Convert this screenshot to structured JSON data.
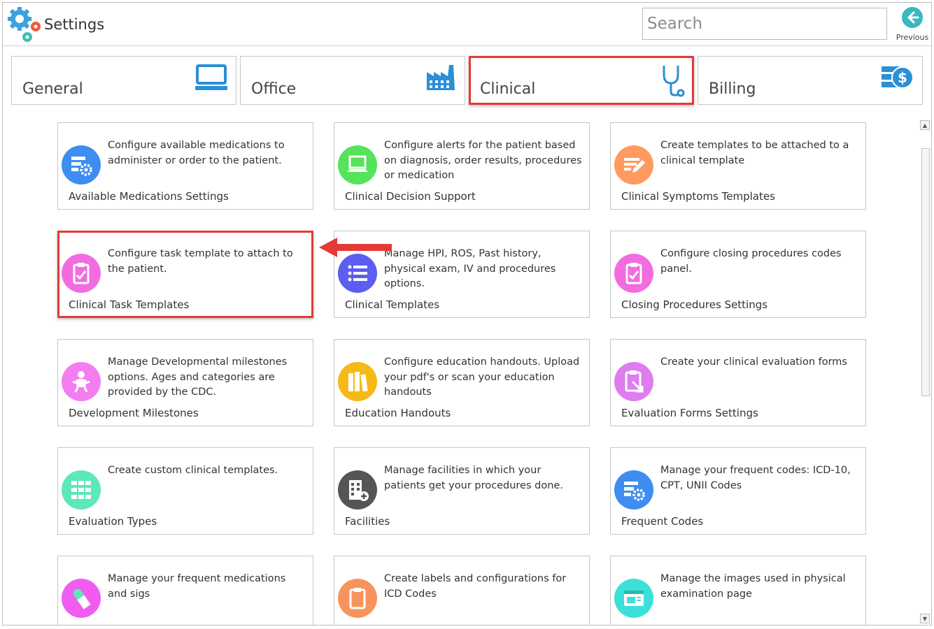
{
  "app": {
    "title": "Settings",
    "logo_icon": "gears-icon"
  },
  "search": {
    "placeholder": "Search"
  },
  "previous": {
    "label": "Previous",
    "icon": "arrow-left-icon"
  },
  "tabs": [
    {
      "label": "General",
      "icon": "monitor-icon",
      "selected": false
    },
    {
      "label": "Office",
      "icon": "factory-icon",
      "selected": false
    },
    {
      "label": "Clinical",
      "icon": "stethoscope-icon",
      "selected": true
    },
    {
      "label": "Billing",
      "icon": "money-icon",
      "selected": false
    }
  ],
  "cards": [
    {
      "title": "Available Medications Settings",
      "desc": "Configure available medications to administer or order to the patient.",
      "icon": "settings-list-icon",
      "color": "#3d8ef0"
    },
    {
      "title": "Clinical Decision Support",
      "desc": "Configure alerts for the patient based on diagnosis, order results, procedures or medication",
      "icon": "laptop-icon",
      "color": "#54e35a"
    },
    {
      "title": "Clinical Symptoms Templates",
      "desc": "Create templates to be attached to a clinical template",
      "icon": "edit-lines-icon",
      "color": "#ff9b5e"
    },
    {
      "title": "Clinical Task Templates",
      "desc": "Configure task template to attach to the patient.",
      "icon": "clipboard-check-icon",
      "color": "#f26ce0",
      "highlighted": true
    },
    {
      "title": "Clinical Templates",
      "desc": "Manage HPI, ROS, Past history, physical exam, IV and procedures options.",
      "icon": "list-icon",
      "color": "#5b5ef0"
    },
    {
      "title": "Closing Procedures Settings",
      "desc": "Configure closing procedures codes panel.",
      "icon": "clipboard-check-icon",
      "color": "#f26ce0"
    },
    {
      "title": "Development Milestones",
      "desc": "Manage Developmental milestones options. Ages and categories are provided by the CDC.",
      "icon": "baby-icon",
      "color": "#f47df0"
    },
    {
      "title": "Education Handouts",
      "desc": "Configure education handouts. Upload your pdf's or scan your education handouts",
      "icon": "books-icon",
      "color": "#f5b918"
    },
    {
      "title": "Evaluation Forms Settings",
      "desc": "Create your clinical evaluation forms",
      "icon": "form-icon",
      "color": "#df7df0"
    },
    {
      "title": "Evaluation Types",
      "desc": "Create custom clinical templates.",
      "icon": "grid-icon",
      "color": "#5ce8b8"
    },
    {
      "title": "Facilities",
      "desc": "Manage facilities in which your patients get your procedures done.",
      "icon": "building-add-icon",
      "color": "#555555"
    },
    {
      "title": "Frequent Codes",
      "desc": "Manage your frequent codes: ICD-10, CPT, UNII Codes",
      "icon": "settings-list-icon",
      "color": "#3d8ef0"
    },
    {
      "title": "",
      "desc": "Manage your frequent medications and sigs",
      "icon": "pill-icon",
      "color": "#f05cf0"
    },
    {
      "title": "",
      "desc": "Create labels and configurations for ICD Codes",
      "icon": "clipboard-icon",
      "color": "#f7945e"
    },
    {
      "title": "",
      "desc": "Manage the images used in physical examination page",
      "icon": "image-icon",
      "color": "#3de0d8"
    }
  ]
}
